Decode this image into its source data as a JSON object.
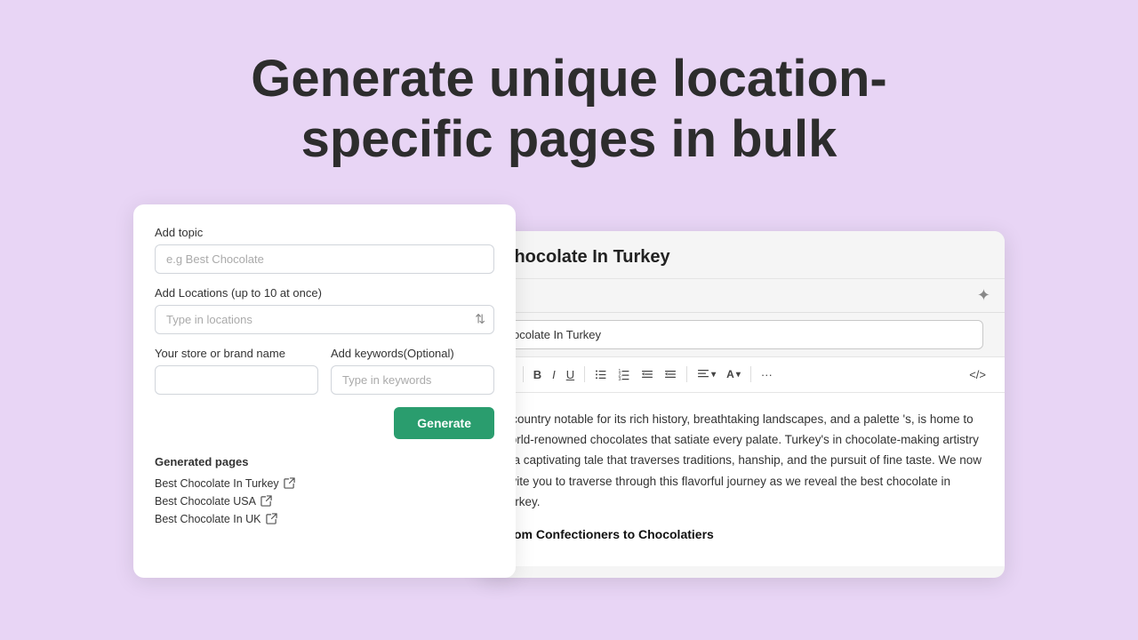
{
  "page": {
    "background_color": "#e8d5f5",
    "title": "Generate unique location-specific pages in bulk"
  },
  "form": {
    "topic_label": "Add topic",
    "topic_placeholder": "e.g Best Chocolate",
    "location_label": "Add Locations (up to 10 at once)",
    "location_placeholder": "Type in locations",
    "brand_label": "Your store or brand name",
    "brand_placeholder": "",
    "keywords_label": "Add keywords(Optional)",
    "keywords_placeholder": "Type in keywords",
    "generate_button": "Generate",
    "generated_pages_title": "Generated pages",
    "generated_pages": [
      {
        "label": "Best Chocolate In Turkey",
        "url": "#"
      },
      {
        "label": "Best Chocolate USA",
        "url": "#"
      },
      {
        "label": "Best Chocolate In UK",
        "url": "#"
      }
    ]
  },
  "editor": {
    "title": "Chocolate In Turkey",
    "meta_input_value": "ocolate In Turkey",
    "toolbar": {
      "font_label": "A",
      "bold": "B",
      "italic": "I",
      "underline": "U",
      "bullet_list": "≡",
      "ordered_list": "≡",
      "indent_decrease": "←",
      "indent_increase": "→",
      "align": "≡",
      "color": "A",
      "more": "···",
      "code": "<>"
    },
    "content_text": "a country notable for its rich history, breathtaking landscapes, and a palette 's, is home to world-renowned chocolates that satiate every palate. Turkey's in chocolate-making artistry is a captivating tale that traverses traditions, hanship, and the pursuit of fine taste. We now invite you to traverse through this flavorful journey as we reveal the best chocolate in Turkey.",
    "section_heading": "From Confectioners to Chocolatiers"
  }
}
